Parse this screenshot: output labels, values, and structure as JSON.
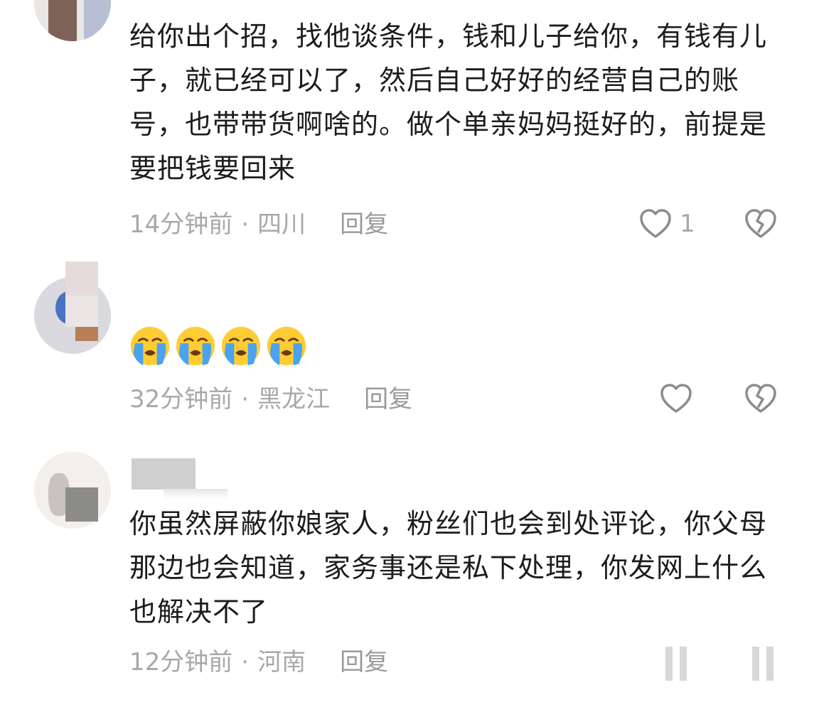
{
  "comments": [
    {
      "text": "给你出个招，找他谈条件，钱和儿子给你，有钱有儿子，就已经可以了，然后自己好好的经营自己的账号，也带带货啊啥的。做个单亲妈妈挺好的，前提是要把钱要回来",
      "time": "14分钟前",
      "location": "四川",
      "reply_label": "回复",
      "like_count": "1"
    },
    {
      "emoji": [
        "loudly-crying-face",
        "loudly-crying-face",
        "loudly-crying-face",
        "loudly-crying-face"
      ],
      "time": "32分钟前",
      "location": "黑龙江",
      "reply_label": "回复",
      "like_count": ""
    },
    {
      "text": "你虽然屏蔽你娘家人，粉丝们也会到处评论，你父母那边也会知道，家务事还是私下处理，你发网上什么也解决不了",
      "time": "12分钟前",
      "location": "河南",
      "reply_label": "回复",
      "like_count": ""
    }
  ],
  "meta_separator": "·",
  "icons": {
    "like": "heart-outline-icon",
    "dislike": "broken-heart-icon"
  },
  "colors": {
    "meta_text": "#a8a8a8",
    "body_text": "#1c1c1c",
    "emoji_yellow": "#ffcc33",
    "tears": "#4aa3f0"
  }
}
